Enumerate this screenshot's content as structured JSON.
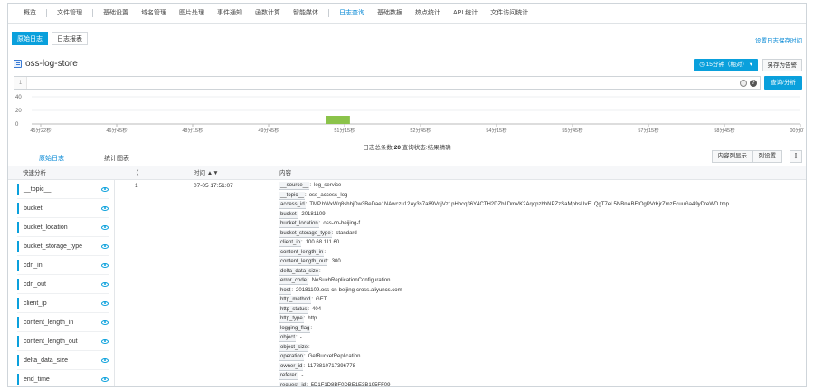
{
  "nav": {
    "items": [
      "概览",
      "文件管理",
      "基础设置",
      "域名管理",
      "图片处理",
      "事件通知",
      "函数计算",
      "智能媒体",
      "日志查询",
      "基础数据",
      "热点统计",
      "API 统计",
      "文件访问统计"
    ],
    "active": "日志查询"
  },
  "subtabs": [
    "原始日志",
    "日志报表"
  ],
  "save_link": "设置日志保存时间",
  "store": {
    "name": "oss-log-store",
    "time_button": "15分钟（相对）",
    "saveas_button": "另存为告警"
  },
  "query": {
    "line_no": "1",
    "value": "",
    "search_button": "查询/分析"
  },
  "histogram": {
    "y_ticks": [
      "40",
      "20",
      "0"
    ],
    "x_ticks": [
      "45分22秒",
      "46分45秒",
      "48分15秒",
      "49分45秒",
      "51分15秒",
      "52分45秒",
      "54分15秒",
      "55分45秒",
      "57分15秒",
      "58分45秒",
      "00分07秒"
    ],
    "bar_color": "#8bc34a",
    "bar": {
      "x_index": 3.75,
      "width_index": 0.32,
      "value": 12
    }
  },
  "status": {
    "prefix": "日志总条数:",
    "count": "20",
    "suffix": "查询状态:结果精确"
  },
  "result_tabs": [
    "原始日志",
    "统计图表"
  ],
  "result_buttons": {
    "wrap": "内容列显示",
    "columns": "列设置",
    "download": "⇩"
  },
  "table": {
    "quick": "快速分析",
    "collapse": "〈",
    "time_header": "时间 ▲▼",
    "content_header": "内容"
  },
  "fields": [
    "__topic__",
    "bucket",
    "bucket_location",
    "bucket_storage_type",
    "cdn_in",
    "cdn_out",
    "client_ip",
    "content_length_in",
    "content_length_out",
    "delta_data_size",
    "end_time"
  ],
  "row": {
    "index": "1",
    "time": "07-05 17:51:07",
    "content": [
      {
        "k": "__source__",
        "v": "log_service"
      },
      {
        "k": "__topic__",
        "v": "oss_access_log"
      },
      {
        "k": "access_id",
        "v": "TMP.hWxWq8shhjDw3BeDae1NAwczu12Ay3s7a89VnjVz1pHbcq36Y4CTH2DZbLDmVK2AqopzbhNPZzSaMphsUvELQgT7eL5NBnABFfOgPVrKjrZmzFcuuGa49yDreWD.tmp"
      },
      {
        "k": "bucket",
        "v": "20181109"
      },
      {
        "k": "bucket_location",
        "v": "oss-cn-beijing-f"
      },
      {
        "k": "bucket_storage_type",
        "v": "standard"
      },
      {
        "k": "client_ip",
        "v": "100.68.111.60"
      },
      {
        "k": "content_length_in",
        "v": "-"
      },
      {
        "k": "content_length_out",
        "v": "300"
      },
      {
        "k": "delta_data_size",
        "v": "-"
      },
      {
        "k": "error_code",
        "v": "NoSuchReplicationConfiguration"
      },
      {
        "k": "host",
        "v": "20181109.oss-cn-beijing-cross.aliyuncs.com"
      },
      {
        "k": "http_method",
        "v": "GET"
      },
      {
        "k": "http_status",
        "v": "404"
      },
      {
        "k": "http_type",
        "v": "http"
      },
      {
        "k": "logging_flag",
        "v": "-"
      },
      {
        "k": "object",
        "v": "-"
      },
      {
        "k": "object_size",
        "v": "-"
      },
      {
        "k": "operation",
        "v": "GetBucketReplication"
      },
      {
        "k": "owner_id",
        "v": "1178810717396778"
      },
      {
        "k": "referer",
        "v": "-"
      },
      {
        "k": "request_id",
        "v": "5D1F1D8BF0DBE1E3B195FF09"
      }
    ]
  }
}
